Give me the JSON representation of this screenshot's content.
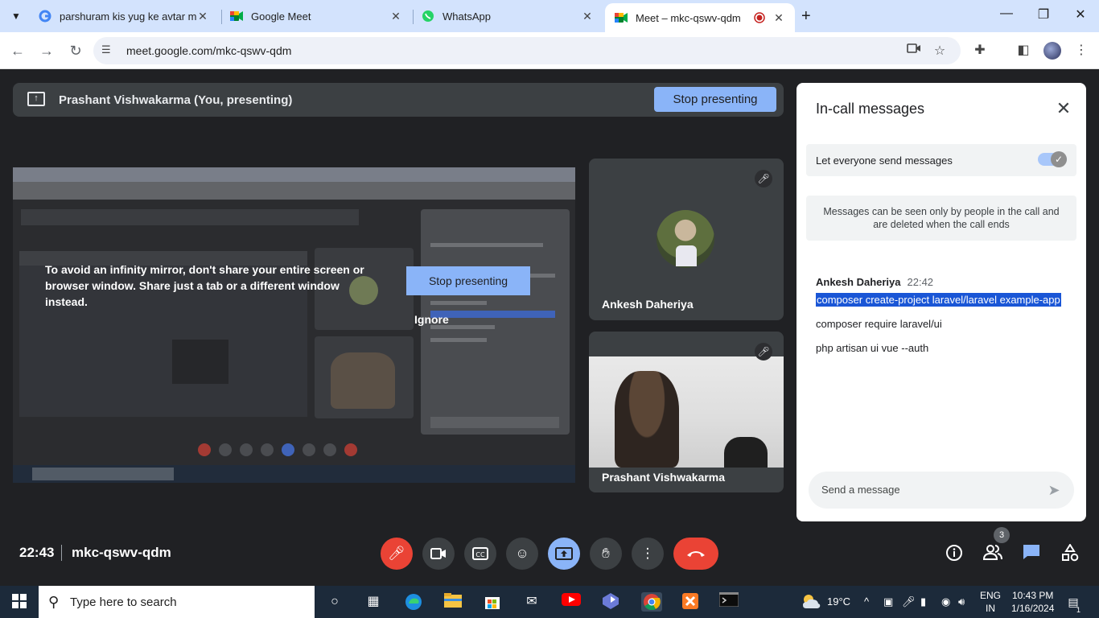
{
  "browser": {
    "tabs": [
      {
        "title": "parshuram kis yug ke avtar mai",
        "icon": "google-icon",
        "active": false
      },
      {
        "title": "Google Meet",
        "icon": "meet-icon",
        "active": false
      },
      {
        "title": "WhatsApp",
        "icon": "whatsapp-icon",
        "active": false
      },
      {
        "title": "Meet – mkc-qswv-qdm",
        "icon": "meet-icon",
        "active": true,
        "recording": true
      }
    ],
    "url": "meet.google.com/mkc-qswv-qdm"
  },
  "presenting_bar": {
    "name": "Prashant Vishwakarma (You, presenting)",
    "stop_label": "Stop presenting"
  },
  "shared_screen": {
    "warning": "To avoid an infinity mirror, don't share your entire screen or browser window. Share just a tab or a different window instead.",
    "stop_label": "Stop presenting",
    "ignore_label": "Ignore"
  },
  "participants": [
    {
      "name": "Ankesh Daheriya",
      "muted": true,
      "video": false
    },
    {
      "name": "Prashant Vishwakarma",
      "muted": true,
      "video": true
    }
  ],
  "chat_panel": {
    "title": "In-call messages",
    "toggle_label": "Let everyone send messages",
    "toggle_on": true,
    "info": "Messages can be seen only by people in the call and are deleted when the call ends",
    "message_group": {
      "sender": "Ankesh Daheriya",
      "time": "22:42",
      "messages": [
        "composer create-project laravel/laravel example-app",
        "composer require laravel/ui",
        "php artisan ui vue --auth"
      ]
    },
    "input_placeholder": "Send a message"
  },
  "bottom_bar": {
    "time": "22:43",
    "meeting_code": "mkc-qswv-qdm",
    "people_count": "3",
    "colors": {
      "danger": "#ea4335",
      "accent": "#8ab4f8"
    }
  },
  "taskbar": {
    "search_placeholder": "Type here to search",
    "weather": "19°C",
    "lang_line1": "ENG",
    "lang_line2": "IN",
    "time": "10:43 PM",
    "date": "1/16/2024",
    "notifications": "1"
  }
}
